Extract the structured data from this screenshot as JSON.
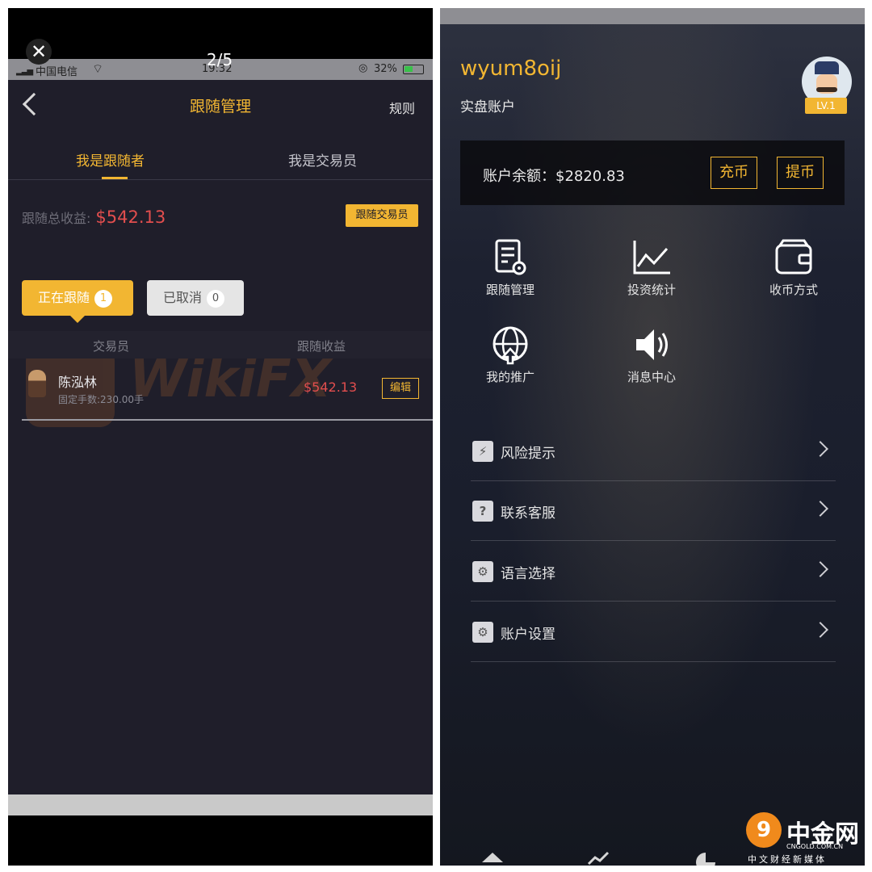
{
  "viewer": {
    "close_symbol": "✕",
    "pager": "2/5"
  },
  "status_bar": {
    "carrier": "中国电信",
    "time": "19:32",
    "battery": "32%"
  },
  "left_app": {
    "nav": {
      "title": "跟随管理",
      "rule": "规则"
    },
    "tabs": {
      "follower": "我是跟随者",
      "trader": "我是交易员"
    },
    "total_label": "跟随总收益:",
    "total_amount": "$542.13",
    "follow_trader_button": "跟随交易员",
    "segments": {
      "following_label": "正在跟随",
      "following_count": "1",
      "cancelled_label": "已取消",
      "cancelled_count": "0"
    },
    "table": {
      "col_trader": "交易员",
      "col_profit": "跟随收益",
      "rows": [
        {
          "name": "陈泓林",
          "lots": "固定手数:230.00手",
          "profit": "$542.13",
          "action": "编辑"
        }
      ]
    },
    "watermark": "WikiFX"
  },
  "right_app": {
    "username": "wyum8oij",
    "account_type": "实盘账户",
    "level": "LV.1",
    "balance_text": "账户余额：$2820.83",
    "deposit": "充币",
    "withdraw": "提币",
    "grid": [
      {
        "label": "跟随管理",
        "icon": "document-gear-icon"
      },
      {
        "label": "投资统计",
        "icon": "line-chart-icon"
      },
      {
        "label": "收币方式",
        "icon": "wallet-icon"
      },
      {
        "label": "我的推广",
        "icon": "globe-icon"
      },
      {
        "label": "消息中心",
        "icon": "speaker-icon"
      }
    ],
    "menu": [
      {
        "label": "风险提示",
        "icon_char": "⚡"
      },
      {
        "label": "联系客服",
        "icon_char": "?"
      },
      {
        "label": "语言选择",
        "icon_char": "⚙"
      },
      {
        "label": "账户设置",
        "icon_char": "⚙"
      }
    ]
  },
  "brand": {
    "name": "中金网",
    "domain": "CNGOLD.COM.CN",
    "tagline": "中文财经新媒体"
  },
  "colors": {
    "accent": "#f2b632",
    "negative": "#e24e4e",
    "background": "#1f1e2a"
  }
}
